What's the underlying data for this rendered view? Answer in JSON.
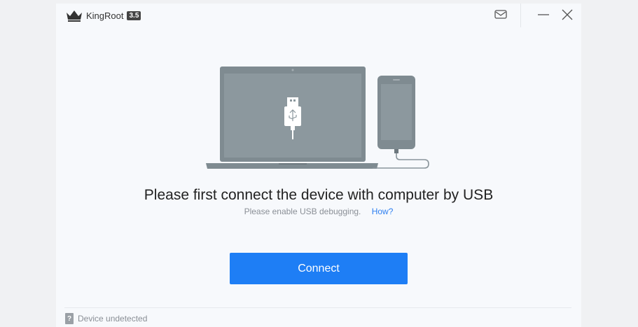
{
  "app": {
    "name": "KingRoot",
    "version": "3.5"
  },
  "titlebar": {
    "icons": [
      "crown-logo-icon",
      "mail-icon",
      "minimize-icon",
      "close-icon"
    ]
  },
  "main": {
    "headline": "Please first connect the device with computer by USB",
    "hint": "Please enable USB debugging.",
    "how_link": "How?",
    "connect_label": "Connect",
    "illustration_icons": [
      "laptop-icon",
      "usb-plug-icon",
      "phone-icon"
    ]
  },
  "footer": {
    "status": "Device undetected",
    "status_icon": "?"
  },
  "colors": {
    "accent": "#1e7ef5",
    "link": "#2e7ff0",
    "device_gray": "#7f8b91",
    "window_bg": "#f7f9fc"
  }
}
